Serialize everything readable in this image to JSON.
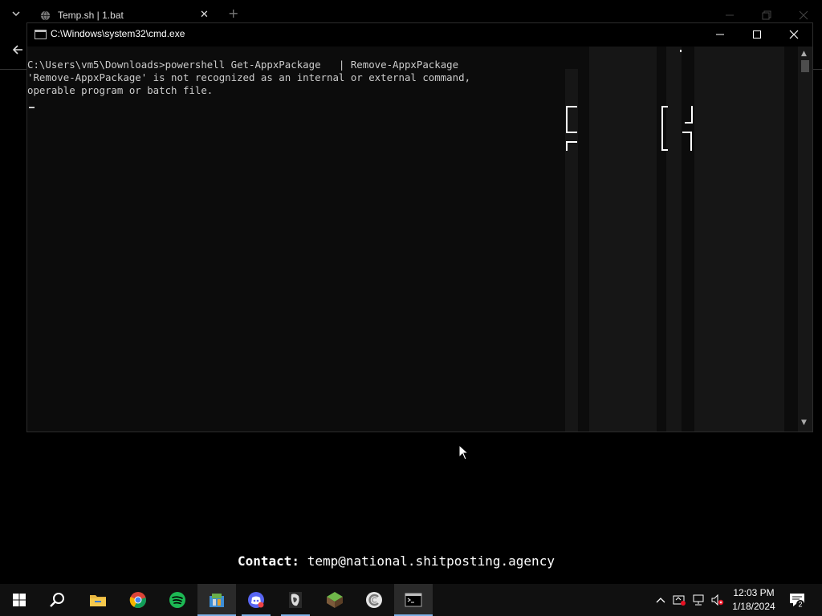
{
  "browser": {
    "tab_title": "Temp.sh | 1.bat",
    "new_tab_symbol": "+"
  },
  "cmd": {
    "title": "C:\\Windows\\system32\\cmd.exe",
    "lines": [
      "C:\\Users\\vm5\\Downloads>powershell Get-AppxPackage   | Remove-AppxPackage",
      "'Remove-AppxPackage' is not recognized as an internal or external command,",
      "operable program or batch file."
    ]
  },
  "desktop": {
    "contact_label": "Contact:",
    "contact_email": "temp@national.shitposting.agency"
  },
  "taskbar": {
    "apps": [
      "start-icon",
      "search-icon",
      "file-explorer-icon",
      "chrome-icon",
      "spotify-icon",
      "app-installer-icon",
      "discord-icon",
      "ollydbg-icon",
      "minecraft-icon",
      "ccleaner-icon",
      "cmd-icon"
    ],
    "time": "12:03 PM",
    "date": "1/18/2024",
    "notification_count": "2"
  },
  "colors": {
    "taskbar_bg": "#101010",
    "console_bg": "#0c0c0c",
    "console_text": "#cccccc",
    "accent": "#7db0e6"
  }
}
